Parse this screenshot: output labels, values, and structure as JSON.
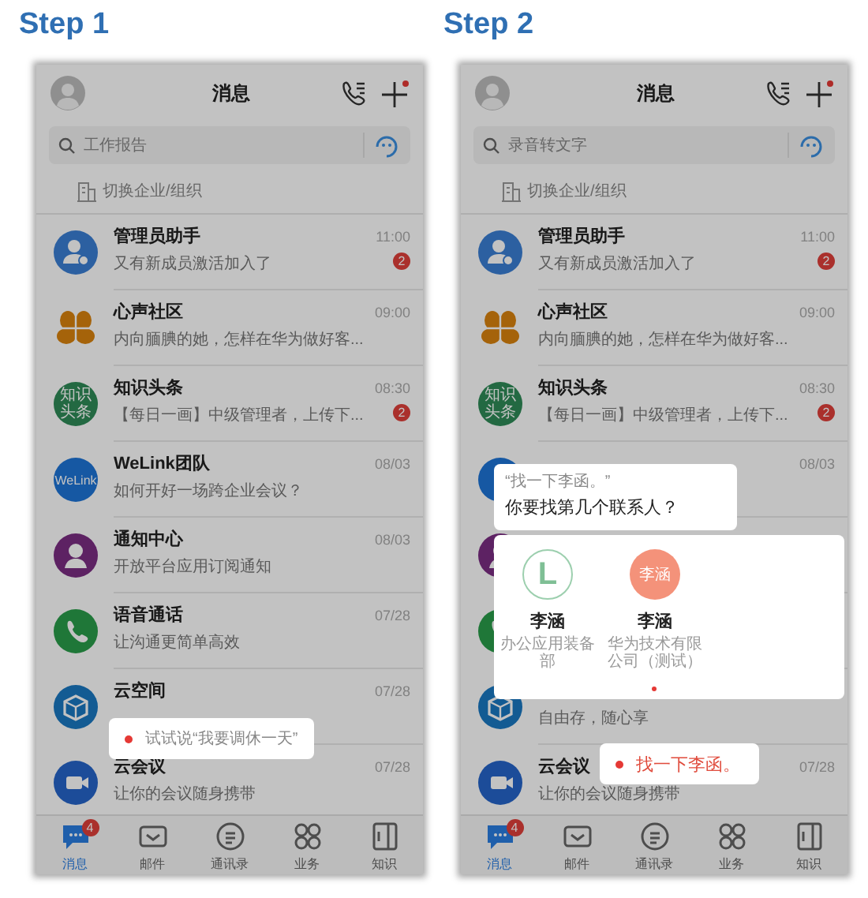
{
  "steps": [
    {
      "label": "Step 1",
      "phone": {
        "header": {
          "title": "消息",
          "plus_dot": true
        },
        "search": {
          "placeholder": "工作报告"
        },
        "switch_org": "切换企业/组织",
        "conversations": [
          {
            "kind": "admin",
            "title": "管理员助手",
            "message": "又有新成员激活加入了",
            "time": "11:00",
            "unread": "2"
          },
          {
            "kind": "flower",
            "title": "心声社区",
            "message": "内向腼腆的她，怎样在华为做好客...",
            "time": "09:00"
          },
          {
            "kind": "knowledge",
            "avatar_text": "知识头条",
            "title": "知识头条",
            "message": "【每日一画】中级管理者，上传下...",
            "time": "08:30",
            "unread": "2"
          },
          {
            "kind": "welink",
            "avatar_text": "WeLink",
            "title": "WeLink团队",
            "message": "如何开好一场跨企业会议？",
            "time": "08/03"
          },
          {
            "kind": "person",
            "title": "通知中心",
            "message": "开放平台应用订阅通知",
            "time": "08/03"
          },
          {
            "kind": "phone",
            "title": "语音通话",
            "message": "让沟通更简单高效",
            "time": "07/28"
          },
          {
            "kind": "cube",
            "title": "云空间",
            "time": "07/28"
          },
          {
            "kind": "video",
            "title": "云会议",
            "message": "让你的会议随身携带",
            "time": "07/28"
          }
        ],
        "tabs": [
          {
            "label": "消息",
            "selected": true,
            "badge": "4"
          },
          {
            "label": "邮件",
            "selected": false
          },
          {
            "label": "通讯录",
            "selected": false
          },
          {
            "label": "业务",
            "selected": false
          },
          {
            "label": "知识",
            "selected": false
          }
        ],
        "voice_prompt": {
          "kind": "hint",
          "text": "试试说“我要调休一天”"
        }
      }
    },
    {
      "label": "Step 2",
      "phone": {
        "header": {
          "title": "消息",
          "plus_dot": true
        },
        "search": {
          "placeholder": "录音转文字"
        },
        "switch_org": "切换企业/组织",
        "conversations": [
          {
            "kind": "admin",
            "title": "管理员助手",
            "message": "又有新成员激活加入了",
            "time": "11:00",
            "unread": "2"
          },
          {
            "kind": "flower",
            "title": "心声社区",
            "message": "内向腼腆的她，怎样在华为做好客...",
            "time": "09:00"
          },
          {
            "kind": "knowledge",
            "avatar_text": "知识头条",
            "title": "知识头条",
            "message": "【每日一画】中级管理者，上传下...",
            "time": "08:30",
            "unread": "2"
          },
          {
            "kind": "welink",
            "time": "08/03"
          },
          {
            "kind": "person"
          },
          {
            "kind": "phone"
          },
          {
            "kind": "cube",
            "message": "自由存，随心享"
          },
          {
            "kind": "video",
            "title": "云会议",
            "message": "让你的会议随身携带",
            "time": "07/28"
          }
        ],
        "tabs": [
          {
            "label": "消息",
            "selected": true,
            "badge": "4"
          },
          {
            "label": "邮件",
            "selected": false
          },
          {
            "label": "通讯录",
            "selected": false
          },
          {
            "label": "业务",
            "selected": false
          },
          {
            "label": "知识",
            "selected": false
          }
        ],
        "question": {
          "quote": "“找一下李函。”",
          "text": "你要找第几个联系人？"
        },
        "contacts": [
          {
            "kind": "logo",
            "avatar_text": "L",
            "name": "李涵",
            "department": "办公应用装备部"
          },
          {
            "kind": "initials",
            "avatar_text": "李涵",
            "name": "李涵",
            "department": "华为技术有限公司（测试）"
          }
        ],
        "voice_prompt": {
          "kind": "recognized",
          "text": "找一下李函。"
        }
      }
    }
  ]
}
